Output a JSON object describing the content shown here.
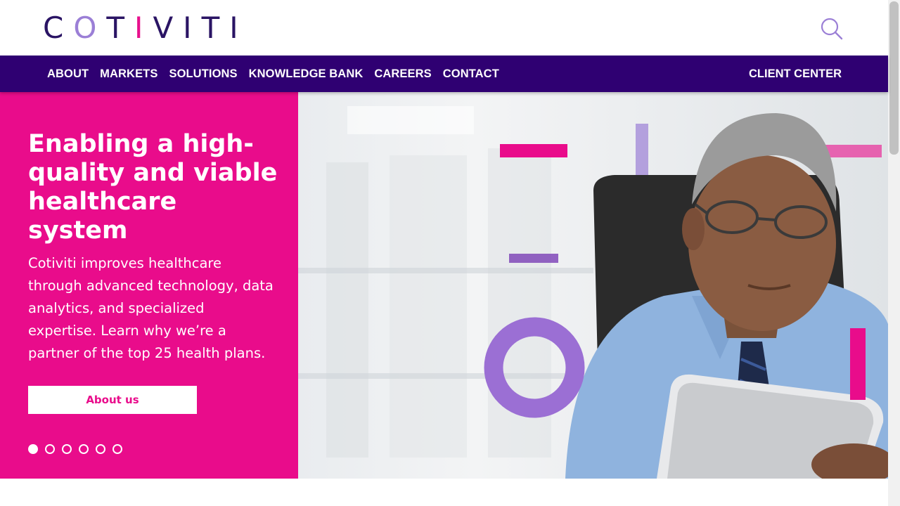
{
  "brand": {
    "logo_text": "COTIVITI",
    "colors": {
      "navy": "#2f0072",
      "magenta": "#e90c8b",
      "lavender": "#9b7fd6",
      "logo_dark": "#2a1464"
    }
  },
  "header": {
    "search_icon": "search-icon"
  },
  "nav": {
    "items": [
      "ABOUT",
      "MARKETS",
      "SOLUTIONS",
      "KNOWLEDGE BANK",
      "CAREERS",
      "CONTACT"
    ],
    "client_center": "CLIENT CENTER"
  },
  "hero": {
    "title": "Enabling a high-quality and viable healthcare system",
    "body": "Cotiviti improves healthcare through advanced technology, data analytics, and specialized expertise. Learn why we’re a partner of the top 25 health plans.",
    "button_label": "About us",
    "slides": {
      "count": 6,
      "active": 1
    }
  }
}
